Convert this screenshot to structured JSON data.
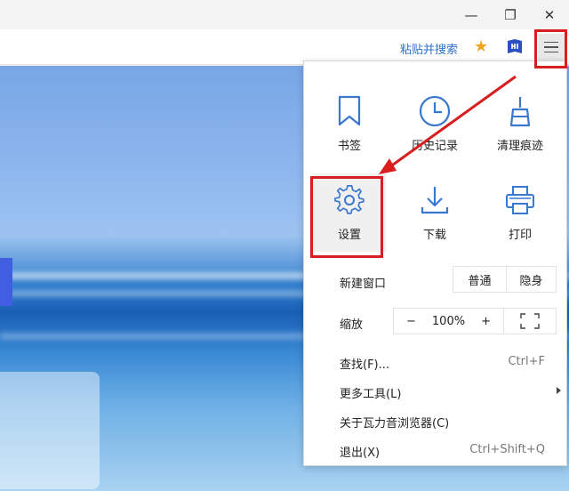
{
  "window_controls": {
    "minimize": "—",
    "restore": "❐",
    "close": "✕"
  },
  "toolbar": {
    "paste_search": "粘贴并搜索"
  },
  "menu": {
    "tiles": [
      {
        "label": "书签"
      },
      {
        "label": "历史记录"
      },
      {
        "label": "清理痕迹"
      },
      {
        "label": "设置"
      },
      {
        "label": "下载"
      },
      {
        "label": "打印"
      }
    ],
    "new_window": {
      "label": "新建窗口",
      "normal": "普通",
      "incognito": "隐身"
    },
    "zoom": {
      "label": "缩放",
      "minus": "−",
      "value": "100%",
      "plus": "+"
    },
    "find": {
      "label": "查找(F)...",
      "shortcut": "Ctrl+F"
    },
    "more_tools": {
      "label": "更多工具(L)"
    },
    "about": {
      "label": "关于瓦力音浏览器(C)"
    },
    "exit": {
      "label": "退出(X)",
      "shortcut": "Ctrl+Shift+Q"
    }
  },
  "colors": {
    "accent": "#2f6fc9",
    "highlight": "#d81e1e",
    "star": "#f3a51d"
  }
}
